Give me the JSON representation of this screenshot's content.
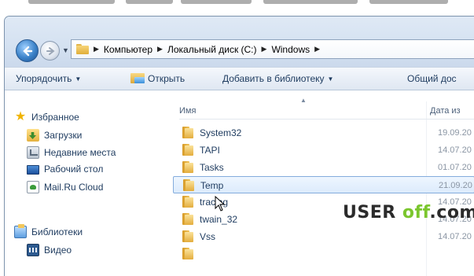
{
  "address_bar": {
    "crumbs": [
      "Компьютер",
      "Локальный диск (C:)",
      "Windows"
    ]
  },
  "toolbar": {
    "organize_label": "Упорядочить",
    "open_label": "Открыть",
    "add_library_label": "Добавить в библиотеку",
    "share_label": "Общий дос"
  },
  "nav_pane": {
    "favorites_label": "Избранное",
    "favorites": [
      "Загрузки",
      "Недавние места",
      "Рабочий стол",
      "Mail.Ru Cloud"
    ],
    "libraries_label": "Библиотеки",
    "libraries": [
      "Видео"
    ]
  },
  "file_list": {
    "col_name": "Имя",
    "col_date": "Дата из",
    "rows": [
      {
        "name": "System32",
        "date": "19.09.20",
        "selected": false
      },
      {
        "name": "TAPI",
        "date": "14.07.20",
        "selected": false
      },
      {
        "name": "Tasks",
        "date": "01.07.20",
        "selected": false
      },
      {
        "name": "Temp",
        "date": "21.09.20",
        "selected": true
      },
      {
        "name": "tracing",
        "date": "14.07.20",
        "selected": false
      },
      {
        "name": "twain_32",
        "date": "14.07.20",
        "selected": false
      },
      {
        "name": "Vss",
        "date": "14.07.20",
        "selected": false
      }
    ]
  },
  "watermark": {
    "part1": "USER",
    "part2": "off",
    "part3": ".com"
  },
  "icons": {
    "favorites": "star-icon",
    "downloads": "downloads-icon",
    "recent": "recent-places-icon",
    "desktop": "desktop-icon",
    "cloud": "cloud-icon",
    "libraries": "libraries-icon",
    "video": "video-icon"
  },
  "colors": {
    "accent_blue": "#3b82c9",
    "selection_border": "#84acdd",
    "watermark_green": "#7bc62e"
  }
}
